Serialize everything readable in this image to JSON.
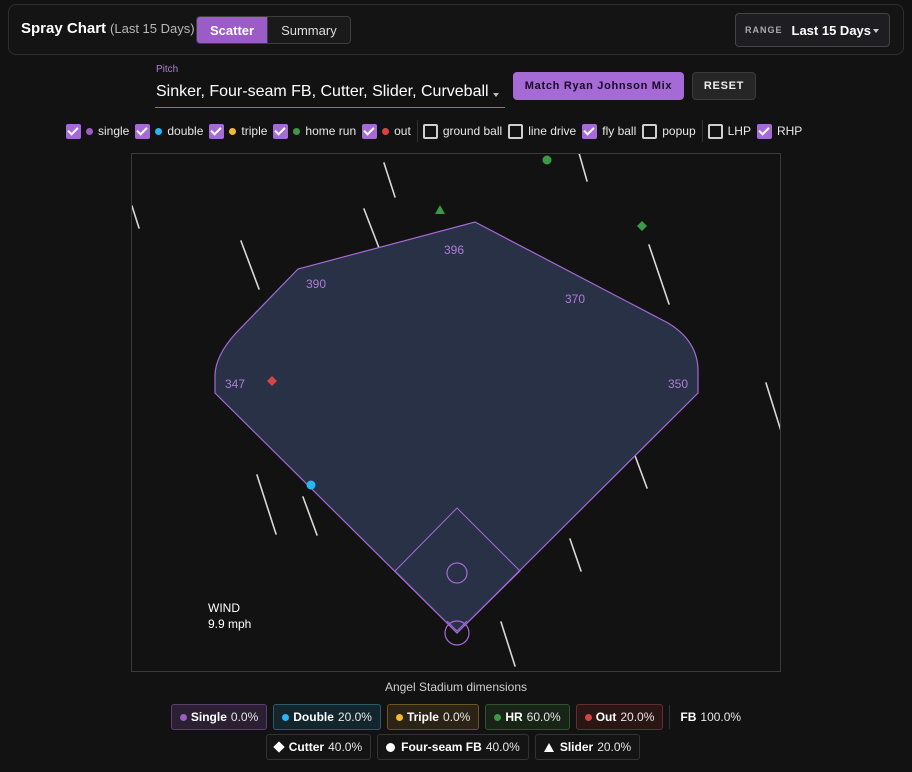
{
  "header": {
    "title": "Spray Chart",
    "subtitle": "(Last 15 Days)",
    "tabs": [
      "Scatter",
      "Summary"
    ],
    "range_label": "RANGE",
    "range_value": "Last 15 Days"
  },
  "pitch": {
    "label": "Pitch",
    "value": "Sinker, Four-seam FB, Cutter, Slider, Curveball"
  },
  "buttons": {
    "match": "Match Ryan Johnson Mix",
    "reset": "RESET"
  },
  "filters": {
    "outcomes": [
      {
        "label": "single",
        "checked": true,
        "color": "#9b5cc8"
      },
      {
        "label": "double",
        "checked": true,
        "color": "#29b6f6"
      },
      {
        "label": "triple",
        "checked": true,
        "color": "#f5b82e"
      },
      {
        "label": "home run",
        "checked": true,
        "color": "#3a9a45"
      },
      {
        "label": "out",
        "checked": true,
        "color": "#d84444"
      }
    ],
    "batted_ball": [
      {
        "label": "ground ball",
        "checked": false
      },
      {
        "label": "line drive",
        "checked": false
      },
      {
        "label": "fly ball",
        "checked": true
      },
      {
        "label": "popup",
        "checked": false
      }
    ],
    "handedness": [
      {
        "label": "LHP",
        "checked": false
      },
      {
        "label": "RHP",
        "checked": true
      }
    ]
  },
  "field": {
    "distances": {
      "lf": "347",
      "lcf": "390",
      "cf": "396",
      "rcf": "370",
      "rf": "350"
    },
    "wind_label": "WIND",
    "wind_value": "9.9 mph",
    "stadium_caption": "Angel Stadium dimensions",
    "colors": {
      "fill": "#283145",
      "line": "#a56ad6",
      "label": "#b07bd8"
    }
  },
  "legend": {
    "outcomes": [
      {
        "name": "Single",
        "pct": "0.0%",
        "color": "#9b5cc8",
        "cls": "single"
      },
      {
        "name": "Double",
        "pct": "20.0%",
        "color": "#29b6f6",
        "cls": "double"
      },
      {
        "name": "Triple",
        "pct": "0.0%",
        "color": "#f5b82e",
        "cls": "triple"
      },
      {
        "name": "HR",
        "pct": "60.0%",
        "color": "#3a9a45",
        "cls": "hr"
      },
      {
        "name": "Out",
        "pct": "20.0%",
        "color": "#d84444",
        "cls": "out"
      }
    ],
    "batted_ball": {
      "name": "FB",
      "pct": "100.0%"
    },
    "pitches": [
      {
        "name": "Cutter",
        "pct": "40.0%",
        "shape": "diamond"
      },
      {
        "name": "Four-seam FB",
        "pct": "40.0%",
        "shape": "circle"
      },
      {
        "name": "Slider",
        "pct": "20.0%",
        "shape": "tri"
      }
    ]
  }
}
